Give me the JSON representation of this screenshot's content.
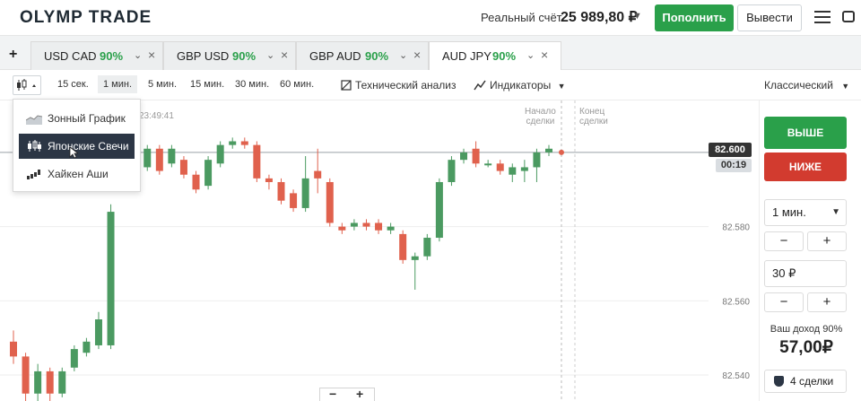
{
  "header": {
    "logo": "OLYMP TRADE",
    "account_label": "Реальный счёт",
    "balance": "25 989,80 ₽",
    "deposit_label": "Пополнить",
    "withdraw_label": "Вывести"
  },
  "tabs": {
    "add_label": "+",
    "items": [
      {
        "pair": "USD CAD",
        "percent": "90%"
      },
      {
        "pair": "GBP USD",
        "percent": "90%"
      },
      {
        "pair": "GBP AUD",
        "percent": "90%"
      },
      {
        "pair": "AUD JPY",
        "percent": "90%"
      }
    ]
  },
  "toolbar": {
    "timeframes": [
      "15 сек.",
      "1 мин.",
      "5 мин.",
      "15 мин.",
      "30 мин.",
      "60 мин."
    ],
    "active_timeframe": "1 мин.",
    "tech_analysis_label": "Технический анализ",
    "indicators_label": "Индикаторы",
    "chart_style_label": "Классический"
  },
  "chart_type_menu": {
    "items": [
      "Зонный График",
      "Японские Свечи",
      "Хайкен Аши"
    ],
    "selected": "Японские Свечи"
  },
  "chart": {
    "time_label": "23:49:41",
    "deal_start_label_1": "Начало",
    "deal_start_label_2": "сделки",
    "deal_end_label_1": "Конец",
    "deal_end_label_2": "сделки",
    "current_price": "82.600",
    "countdown": "00:19",
    "zoom_minus": "−",
    "zoom_plus": "+"
  },
  "chart_data": {
    "type": "candlestick",
    "y_ticks": [
      "82.580",
      "82.560",
      "82.540"
    ],
    "ylim": [
      82.533,
      82.614
    ],
    "current_price": 82.6,
    "candles": [
      {
        "o": 82.549,
        "c": 82.545,
        "h": 82.552,
        "l": 82.543,
        "dir": "down"
      },
      {
        "o": 82.545,
        "c": 82.535,
        "h": 82.546,
        "l": 82.533,
        "dir": "down"
      },
      {
        "o": 82.535,
        "c": 82.541,
        "h": 82.543,
        "l": 82.533,
        "dir": "up"
      },
      {
        "o": 82.541,
        "c": 82.535,
        "h": 82.542,
        "l": 82.533,
        "dir": "down"
      },
      {
        "o": 82.535,
        "c": 82.541,
        "h": 82.542,
        "l": 82.534,
        "dir": "up"
      },
      {
        "o": 82.542,
        "c": 82.547,
        "h": 82.548,
        "l": 82.541,
        "dir": "up"
      },
      {
        "o": 82.546,
        "c": 82.549,
        "h": 82.55,
        "l": 82.545,
        "dir": "up"
      },
      {
        "o": 82.548,
        "c": 82.555,
        "h": 82.557,
        "l": 82.547,
        "dir": "up"
      },
      {
        "o": 82.548,
        "c": 82.584,
        "h": 82.586,
        "l": 82.547,
        "dir": "up"
      },
      {
        "o": 82.594,
        "c": 82.601,
        "h": 82.603,
        "l": 82.593,
        "dir": "up"
      },
      {
        "o": 82.601,
        "c": 82.596,
        "h": 82.602,
        "l": 82.594,
        "dir": "down"
      },
      {
        "o": 82.596,
        "c": 82.601,
        "h": 82.602,
        "l": 82.595,
        "dir": "up"
      },
      {
        "o": 82.601,
        "c": 82.595,
        "h": 82.602,
        "l": 82.594,
        "dir": "down"
      },
      {
        "o": 82.597,
        "c": 82.601,
        "h": 82.602,
        "l": 82.596,
        "dir": "up"
      },
      {
        "o": 82.598,
        "c": 82.594,
        "h": 82.599,
        "l": 82.593,
        "dir": "down"
      },
      {
        "o": 82.594,
        "c": 82.59,
        "h": 82.595,
        "l": 82.589,
        "dir": "down"
      },
      {
        "o": 82.591,
        "c": 82.598,
        "h": 82.599,
        "l": 82.59,
        "dir": "up"
      },
      {
        "o": 82.597,
        "c": 82.602,
        "h": 82.603,
        "l": 82.596,
        "dir": "up"
      },
      {
        "o": 82.602,
        "c": 82.603,
        "h": 82.604,
        "l": 82.601,
        "dir": "up"
      },
      {
        "o": 82.603,
        "c": 82.602,
        "h": 82.604,
        "l": 82.601,
        "dir": "down"
      },
      {
        "o": 82.602,
        "c": 82.593,
        "h": 82.603,
        "l": 82.592,
        "dir": "down"
      },
      {
        "o": 82.593,
        "c": 82.592,
        "h": 82.594,
        "l": 82.59,
        "dir": "down"
      },
      {
        "o": 82.592,
        "c": 82.587,
        "h": 82.593,
        "l": 82.586,
        "dir": "down"
      },
      {
        "o": 82.589,
        "c": 82.585,
        "h": 82.59,
        "l": 82.584,
        "dir": "down"
      },
      {
        "o": 82.585,
        "c": 82.593,
        "h": 82.599,
        "l": 82.584,
        "dir": "up"
      },
      {
        "o": 82.595,
        "c": 82.593,
        "h": 82.601,
        "l": 82.589,
        "dir": "down"
      },
      {
        "o": 82.592,
        "c": 82.581,
        "h": 82.593,
        "l": 82.58,
        "dir": "down"
      },
      {
        "o": 82.58,
        "c": 82.579,
        "h": 82.581,
        "l": 82.578,
        "dir": "down"
      },
      {
        "o": 82.58,
        "c": 82.581,
        "h": 82.582,
        "l": 82.579,
        "dir": "up"
      },
      {
        "o": 82.581,
        "c": 82.58,
        "h": 82.582,
        "l": 82.579,
        "dir": "down"
      },
      {
        "o": 82.581,
        "c": 82.579,
        "h": 82.582,
        "l": 82.578,
        "dir": "down"
      },
      {
        "o": 82.579,
        "c": 82.58,
        "h": 82.581,
        "l": 82.578,
        "dir": "up"
      },
      {
        "o": 82.578,
        "c": 82.571,
        "h": 82.579,
        "l": 82.57,
        "dir": "down"
      },
      {
        "o": 82.571,
        "c": 82.572,
        "h": 82.573,
        "l": 82.563,
        "dir": "up"
      },
      {
        "o": 82.572,
        "c": 82.577,
        "h": 82.578,
        "l": 82.571,
        "dir": "up"
      },
      {
        "o": 82.577,
        "c": 82.592,
        "h": 82.593,
        "l": 82.576,
        "dir": "up"
      },
      {
        "o": 82.592,
        "c": 82.598,
        "h": 82.599,
        "l": 82.591,
        "dir": "up"
      },
      {
        "o": 82.598,
        "c": 82.6,
        "h": 82.601,
        "l": 82.597,
        "dir": "up"
      },
      {
        "o": 82.601,
        "c": 82.597,
        "h": 82.603,
        "l": 82.596,
        "dir": "down"
      },
      {
        "o": 82.597,
        "c": 82.597,
        "h": 82.598,
        "l": 82.596,
        "dir": "up"
      },
      {
        "o": 82.597,
        "c": 82.595,
        "h": 82.598,
        "l": 82.594,
        "dir": "down"
      },
      {
        "o": 82.594,
        "c": 82.596,
        "h": 82.597,
        "l": 82.592,
        "dir": "up"
      },
      {
        "o": 82.595,
        "c": 82.596,
        "h": 82.598,
        "l": 82.592,
        "dir": "up"
      },
      {
        "o": 82.596,
        "c": 82.6,
        "h": 82.601,
        "l": 82.592,
        "dir": "up"
      },
      {
        "o": 82.6,
        "c": 82.601,
        "h": 82.602,
        "l": 82.599,
        "dir": "up"
      }
    ]
  },
  "panel": {
    "up_label": "ВЫШЕ",
    "down_label": "НИЖЕ",
    "duration_value": "1 мин.",
    "minus": "−",
    "plus": "+",
    "amount_value": "30 ₽",
    "income_label": "Ваш доход 90%",
    "income_value": "57,00₽",
    "deals_label": "4 сделки"
  },
  "colors": {
    "up": "#2aa04a",
    "down": "#d23b2f",
    "candle_up": "#4b9a61",
    "candle_down": "#e0614d"
  }
}
